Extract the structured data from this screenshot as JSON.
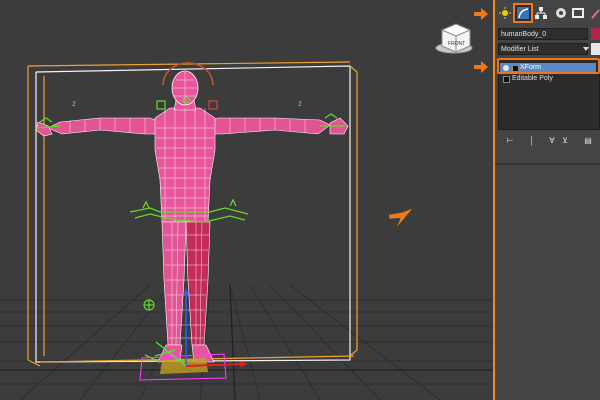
{
  "object_name": "humanBody_0",
  "modifier_list_label": "Modifier List",
  "modifier_stack": [
    {
      "label": "XForm",
      "selected": true
    },
    {
      "label": "Editable Poly",
      "selected": false
    }
  ],
  "viewcube_label": "FRONT",
  "colors": {
    "accent": "#f07a1a",
    "object_color": "#b3234d",
    "selection_blue": "#5a89c4",
    "mesh_pink": "#e8559a",
    "mesh_red": "#c42a5a",
    "wire_white": "#f4f4f4",
    "bone_green": "#5fdc2a"
  },
  "command_tabs": [
    {
      "name": "create-tab",
      "icon": "sun-icon",
      "active": false
    },
    {
      "name": "modify-tab",
      "icon": "modify-icon",
      "active": true
    },
    {
      "name": "hierarchy-tab",
      "icon": "hierarchy-icon",
      "active": false
    },
    {
      "name": "motion-tab",
      "icon": "motion-icon",
      "active": false
    },
    {
      "name": "display-tab",
      "icon": "display-icon",
      "active": false
    },
    {
      "name": "utilities-tab",
      "icon": "wrench-icon",
      "active": false
    }
  ],
  "stack_tools": [
    "pin-stack-icon",
    "show-end-result-icon",
    "make-unique-icon",
    "remove-modifier-icon",
    "configure-sets-icon"
  ]
}
